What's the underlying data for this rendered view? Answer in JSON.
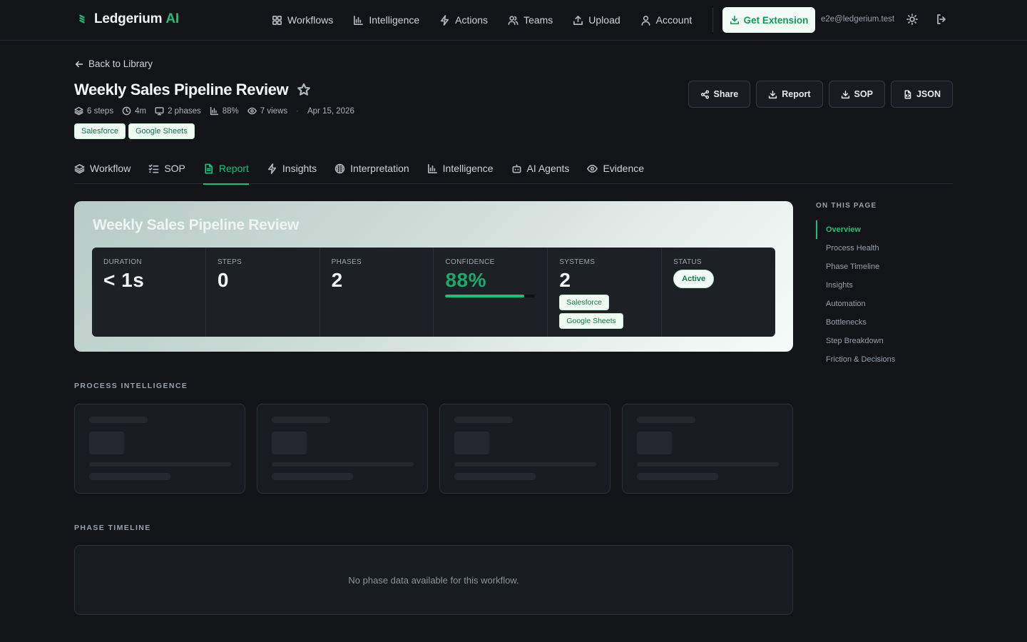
{
  "nav": {
    "brand": "Ledgerium",
    "brand_ai": "AI",
    "links": [
      {
        "label": "Workflows",
        "icon": "grid-icon"
      },
      {
        "label": "Intelligence",
        "icon": "bar-chart-icon"
      },
      {
        "label": "Actions",
        "icon": "lightning-icon"
      },
      {
        "label": "Teams",
        "icon": "users-icon"
      },
      {
        "label": "Upload",
        "icon": "upload-icon"
      },
      {
        "label": "Account",
        "icon": "user-icon"
      }
    ],
    "extension_label": "Get Extension",
    "user_email": "e2e@ledgerium.test"
  },
  "header": {
    "back_label": "Back to Library",
    "title": "Weekly Sales Pipeline Review",
    "meta": {
      "steps": "6 steps",
      "duration": "4m",
      "phases": "2 phases",
      "confidence": "88%",
      "views": "7 views",
      "separator": "·",
      "date": "Apr 15, 2026"
    },
    "tags": [
      "Salesforce",
      "Google Sheets"
    ],
    "actions": {
      "share": "Share",
      "report": "Report",
      "sop": "SOP",
      "json": "JSON"
    }
  },
  "tabs": [
    {
      "label": "Workflow",
      "icon": "layers-icon",
      "active": false
    },
    {
      "label": "SOP",
      "icon": "checklist-icon",
      "active": false
    },
    {
      "label": "Report",
      "icon": "document-icon",
      "active": true
    },
    {
      "label": "Insights",
      "icon": "lightning-icon",
      "active": false
    },
    {
      "label": "Interpretation",
      "icon": "brain-icon",
      "active": false
    },
    {
      "label": "Intelligence",
      "icon": "bar-chart-icon",
      "active": false
    },
    {
      "label": "AI Agents",
      "icon": "bot-icon",
      "active": false
    },
    {
      "label": "Evidence",
      "icon": "eye-icon",
      "active": false
    }
  ],
  "overview": {
    "title": "Weekly Sales Pipeline Review",
    "stats": {
      "duration": {
        "label": "Duration",
        "value": "< 1s"
      },
      "steps": {
        "label": "Steps",
        "value": "0"
      },
      "phases": {
        "label": "Phases",
        "value": "2"
      },
      "confidence": {
        "label": "Confidence",
        "value": "88%",
        "fraction": 0.88
      },
      "systems": {
        "label": "Systems",
        "value": "2",
        "items": [
          "Salesforce",
          "Google Sheets"
        ]
      },
      "status": {
        "label": "Status",
        "value": "Active"
      }
    }
  },
  "toc": {
    "title": "ON THIS PAGE",
    "items": [
      "Overview",
      "Process Health",
      "Phase Timeline",
      "Insights",
      "Automation",
      "Bottlenecks",
      "Step Breakdown",
      "Friction & Decisions"
    ],
    "active_index": 0
  },
  "process_intelligence": {
    "label": "PROCESS INTELLIGENCE",
    "loading_cards": 4
  },
  "phase_timeline": {
    "label": "PHASE TIMELINE",
    "empty_message": "No phase data available for this workflow."
  },
  "colors": {
    "accent": "#1fbf7a",
    "background": "#121418",
    "card": "#1d2126"
  }
}
